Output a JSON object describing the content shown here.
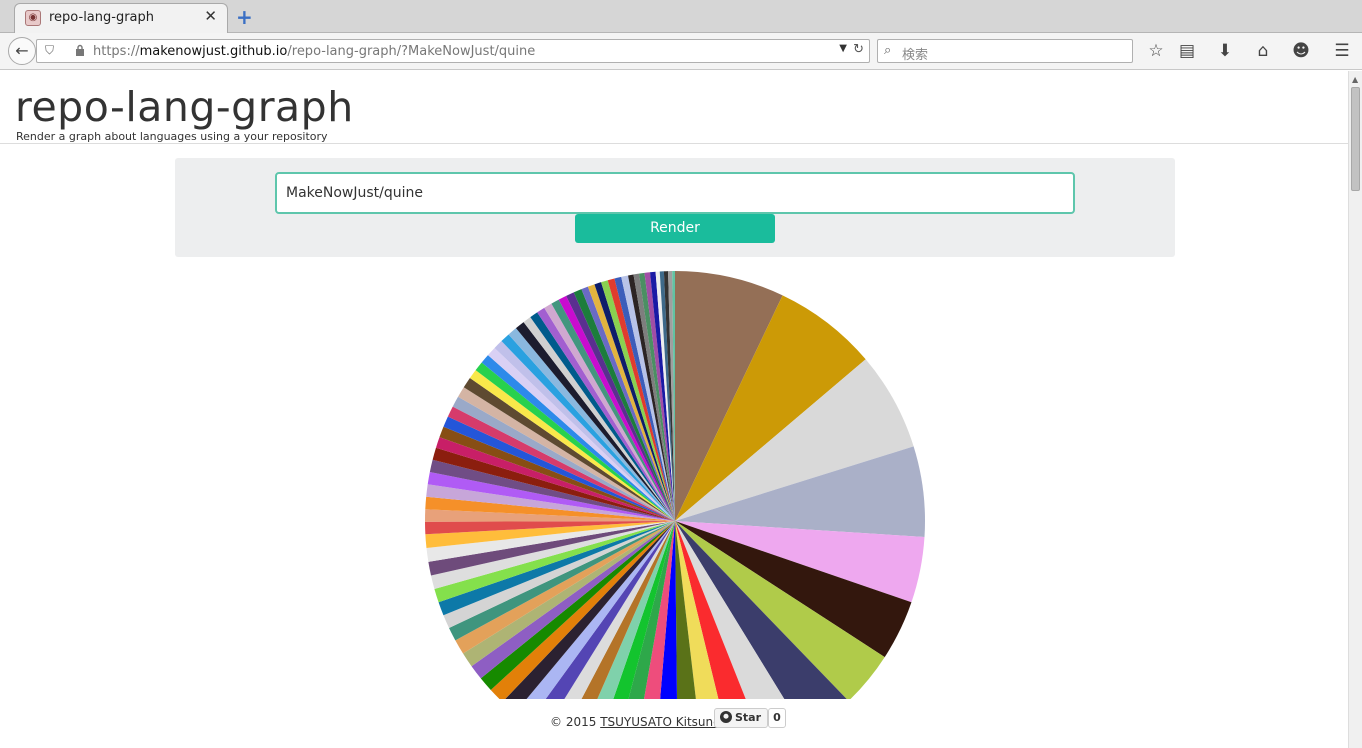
{
  "browser": {
    "tab_title": "repo-lang-graph",
    "url_prefix": "https://",
    "url_host": "makenowjust.github.io",
    "url_path": "/repo-lang-graph/?MakeNowJust/quine",
    "search_placeholder": "検索",
    "icons": [
      "back-arrow-icon",
      "shield-icon",
      "lock-icon",
      "reload-icon",
      "search-icon",
      "star-icon",
      "reading-list-icon",
      "download-icon",
      "home-icon",
      "smiley-icon",
      "hamburger-menu-icon"
    ]
  },
  "header": {
    "title": "repo-lang-graph",
    "subtitle": "Render a graph about languages using a your repository"
  },
  "form": {
    "repo_value": "MakeNowJust/quine",
    "render_label": "Render",
    "accent_color": "#1abc9c"
  },
  "footer": {
    "copyright": "© 2015",
    "author": "TSUYUSATO Kitsune",
    "star_label": "Star",
    "star_count": "0"
  },
  "chart_data": {
    "type": "pie",
    "note_source": "languages",
    "slices": [
      {
        "value": 8.0,
        "color": "#946f56"
      },
      {
        "value": 7.6,
        "color": "#cc9a06"
      },
      {
        "value": 7.2,
        "color": "#d9d9d9"
      },
      {
        "value": 6.6,
        "color": "#aab0c8"
      },
      {
        "value": 4.8,
        "color": "#eea8ef"
      },
      {
        "value": 4.4,
        "color": "#33170d"
      },
      {
        "value": 4.1,
        "color": "#b0cb4a"
      },
      {
        "value": 3.9,
        "color": "#3b3d6b"
      },
      {
        "value": 3.1,
        "color": "#dadada"
      },
      {
        "value": 2.5,
        "color": "#fa2b2e"
      },
      {
        "value": 2.2,
        "color": "#f0dc5a"
      },
      {
        "value": 1.9,
        "color": "#5a7218"
      },
      {
        "value": 1.7,
        "color": "#0000ff"
      },
      {
        "value": 1.6,
        "color": "#ee4d7c"
      },
      {
        "value": 1.5,
        "color": "#2ea84a"
      },
      {
        "value": 1.4,
        "color": "#13c42e"
      },
      {
        "value": 1.4,
        "color": "#7fd1ab"
      },
      {
        "value": 1.3,
        "color": "#b47428"
      },
      {
        "value": 1.3,
        "color": "#dcdcdc"
      },
      {
        "value": 1.3,
        "color": "#5445b4"
      },
      {
        "value": 1.2,
        "color": "#abb6f3"
      },
      {
        "value": 1.2,
        "color": "#2b2131"
      },
      {
        "value": 1.2,
        "color": "#e28009"
      },
      {
        "value": 1.1,
        "color": "#168a00"
      },
      {
        "value": 1.1,
        "color": "#8e5ec3"
      },
      {
        "value": 1.1,
        "color": "#aeb474"
      },
      {
        "value": 1.1,
        "color": "#e3a15a"
      },
      {
        "value": 1.0,
        "color": "#3f957e"
      },
      {
        "value": 1.0,
        "color": "#d4d4d4"
      },
      {
        "value": 1.0,
        "color": "#0d79a8"
      },
      {
        "value": 1.0,
        "color": "#84e04c"
      },
      {
        "value": 1.0,
        "color": "#dedede"
      },
      {
        "value": 1.0,
        "color": "#6e4b7b"
      },
      {
        "value": 1.0,
        "color": "#e8e8e8"
      },
      {
        "value": 1.0,
        "color": "#ffbd3b"
      },
      {
        "value": 0.9,
        "color": "#e04c4c"
      },
      {
        "value": 0.9,
        "color": "#e8a17a"
      },
      {
        "value": 0.9,
        "color": "#f59029"
      },
      {
        "value": 0.9,
        "color": "#c7a6d9"
      },
      {
        "value": 0.9,
        "color": "#b05bf5"
      },
      {
        "value": 0.9,
        "color": "#704d85"
      },
      {
        "value": 0.9,
        "color": "#8b1e0e"
      },
      {
        "value": 0.8,
        "color": "#c81f67"
      },
      {
        "value": 0.8,
        "color": "#874e14"
      },
      {
        "value": 0.8,
        "color": "#2456d9"
      },
      {
        "value": 0.8,
        "color": "#d63b6b"
      },
      {
        "value": 0.8,
        "color": "#9aa9c8"
      },
      {
        "value": 0.8,
        "color": "#d4b4a4"
      },
      {
        "value": 0.8,
        "color": "#5e4a31"
      },
      {
        "value": 0.7,
        "color": "#f9e84a"
      },
      {
        "value": 0.7,
        "color": "#27d14e"
      },
      {
        "value": 0.7,
        "color": "#2d8aea"
      },
      {
        "value": 0.7,
        "color": "#d9d0f4"
      },
      {
        "value": 0.7,
        "color": "#c0c0ea"
      },
      {
        "value": 0.7,
        "color": "#2aa1e0"
      },
      {
        "value": 0.7,
        "color": "#8ab8df"
      },
      {
        "value": 0.7,
        "color": "#1c1c2e"
      },
      {
        "value": 0.6,
        "color": "#d0d0d0"
      },
      {
        "value": 0.6,
        "color": "#005b8c"
      },
      {
        "value": 0.6,
        "color": "#a25fd0"
      },
      {
        "value": 0.6,
        "color": "#d0a8d0"
      },
      {
        "value": 0.6,
        "color": "#43967f"
      },
      {
        "value": 0.6,
        "color": "#c90ccf"
      },
      {
        "value": 0.6,
        "color": "#5a2f90"
      },
      {
        "value": 0.6,
        "color": "#1c7d3c"
      },
      {
        "value": 0.5,
        "color": "#6a6ac5"
      },
      {
        "value": 0.5,
        "color": "#e3b43e"
      },
      {
        "value": 0.5,
        "color": "#0e1d6a"
      },
      {
        "value": 0.5,
        "color": "#8ad150"
      },
      {
        "value": 0.5,
        "color": "#e03c2e"
      },
      {
        "value": 0.5,
        "color": "#3c5dba"
      },
      {
        "value": 0.5,
        "color": "#b8c3e8"
      },
      {
        "value": 0.4,
        "color": "#2c2424"
      },
      {
        "value": 0.4,
        "color": "#7e7e7e"
      },
      {
        "value": 0.4,
        "color": "#4b8f63"
      },
      {
        "value": 0.4,
        "color": "#a14ea6"
      },
      {
        "value": 0.4,
        "color": "#1a1aa5"
      },
      {
        "value": 0.3,
        "color": "#eeeeee"
      },
      {
        "value": 0.3,
        "color": "#3e6a8a"
      },
      {
        "value": 0.3,
        "color": "#333333"
      },
      {
        "value": 0.3,
        "color": "#9f9f9f"
      },
      {
        "value": 0.2,
        "color": "#62c3a3"
      }
    ]
  }
}
